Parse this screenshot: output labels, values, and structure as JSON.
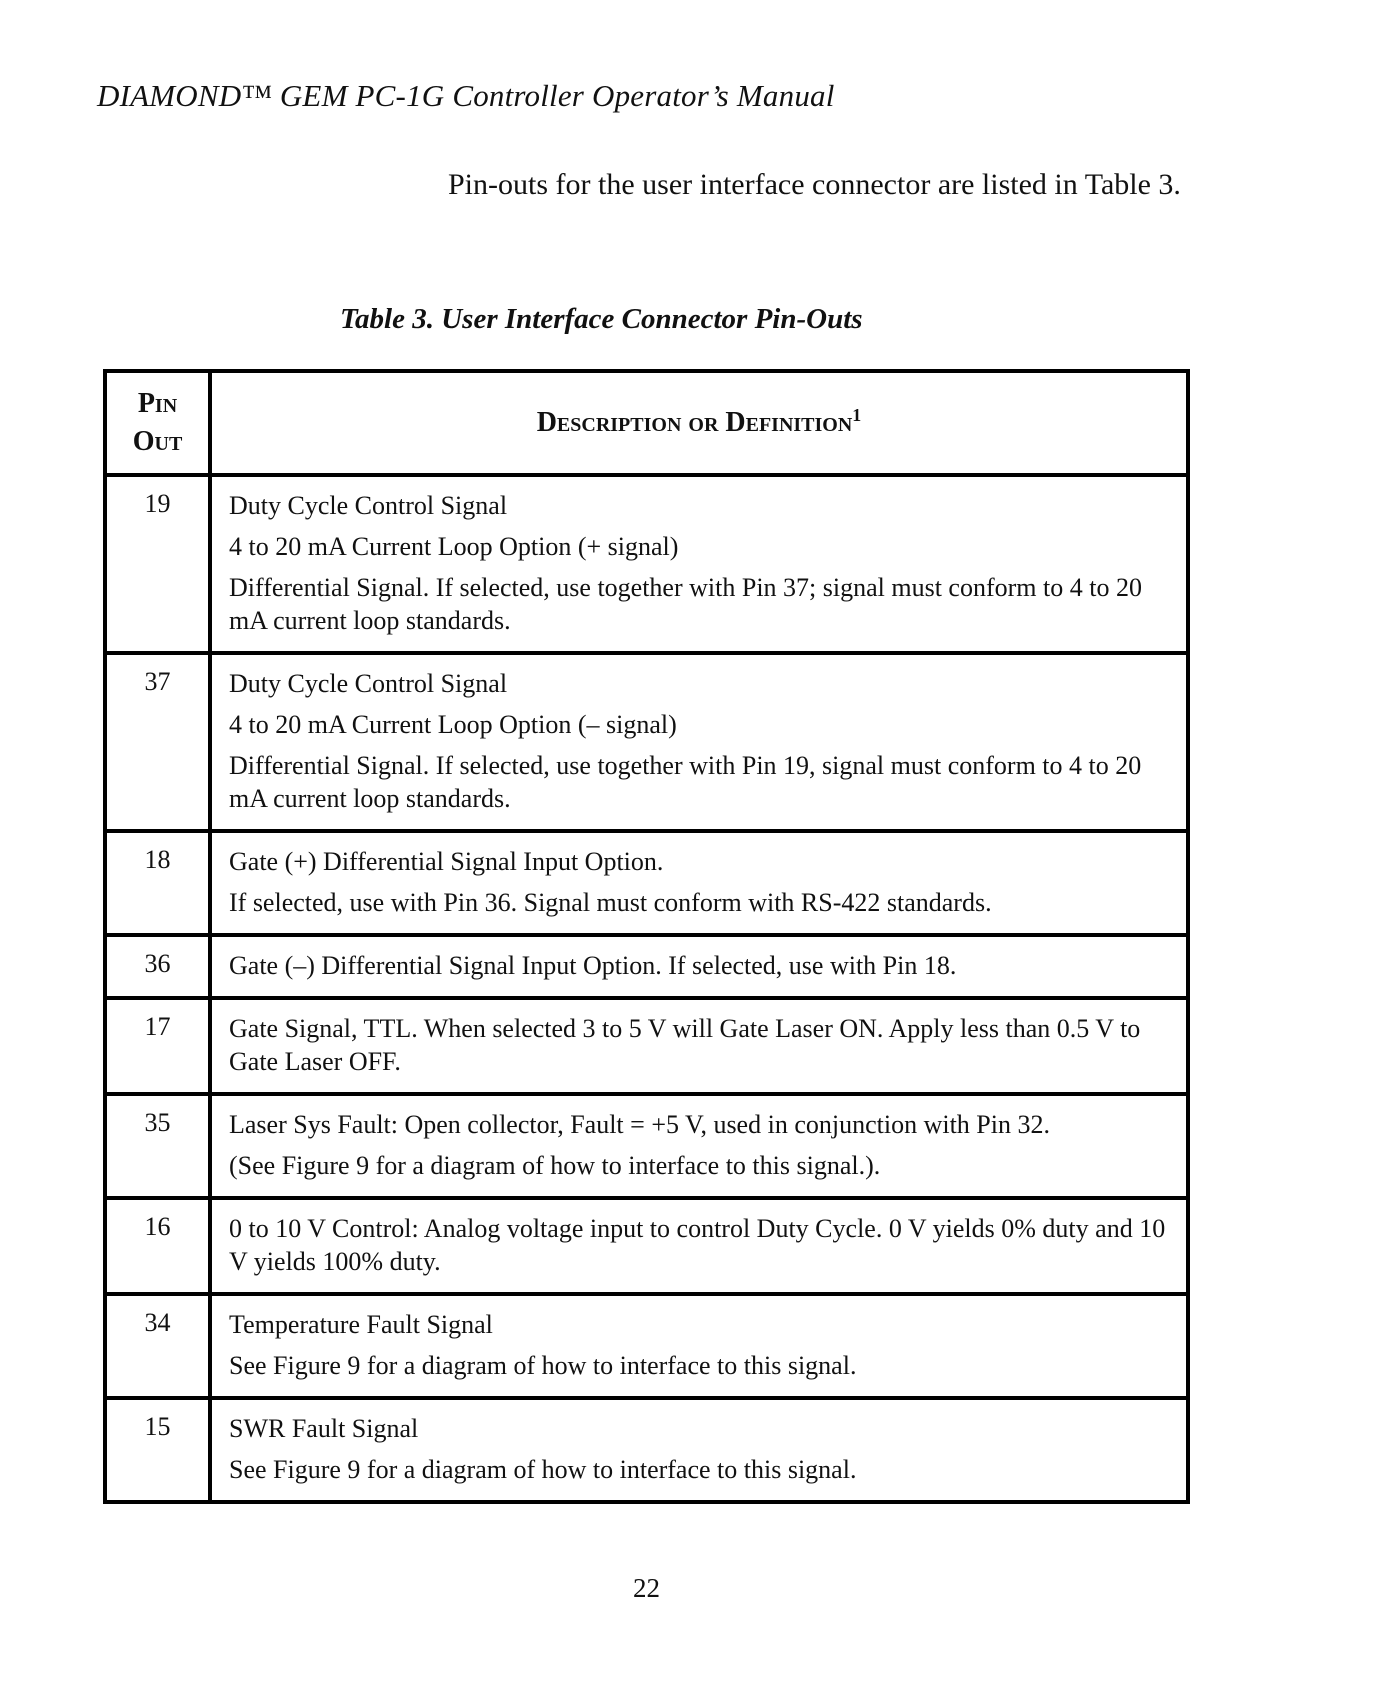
{
  "document": {
    "running_header": "DIAMOND™ GEM PC-1G Controller Operator’s Manual",
    "intro_text": "Pin-outs for the user interface connector are listed in Table 3.",
    "table_caption": "Table 3.  User Interface Connector Pin-Outs",
    "page_number": "22"
  },
  "table": {
    "headers": {
      "pin_line1": "Pin",
      "pin_line2": "Out",
      "description": "Description or Definition",
      "description_footnote": "1"
    },
    "rows": [
      {
        "pin": "19",
        "lines": [
          "Duty Cycle Control Signal",
          "4 to 20 mA Current Loop Option (+ signal)",
          "Differential Signal. If selected, use together with Pin 37; signal must conform to 4 to 20 mA current loop standards."
        ]
      },
      {
        "pin": "37",
        "lines": [
          "Duty Cycle Control Signal",
          "4 to 20 mA Current Loop Option (–  signal)",
          "Differential Signal. If selected, use together with Pin 19, signal must conform to 4 to 20 mA current loop standards."
        ]
      },
      {
        "pin": "18",
        "lines": [
          "Gate (+) Differential Signal Input Option.",
          "If selected, use with Pin 36. Signal must conform with RS-422 standards."
        ]
      },
      {
        "pin": "36",
        "lines": [
          "Gate (–) Differential Signal Input Option. If selected, use with Pin 18."
        ]
      },
      {
        "pin": "17",
        "lines": [
          "Gate Signal, TTL. When selected 3 to 5 V will Gate Laser ON. Apply less than 0.5 V to Gate Laser OFF."
        ]
      },
      {
        "pin": "35",
        "lines": [
          "Laser Sys Fault: Open collector, Fault = +5 V, used in conjunction with Pin 32.",
          "(See Figure 9 for a diagram of how to interface to this signal.)."
        ]
      },
      {
        "pin": "16",
        "lines": [
          "0 to 10 V Control: Analog voltage input to control Duty Cycle. 0 V yields 0% duty and 10 V yields 100% duty."
        ]
      },
      {
        "pin": "34",
        "lines": [
          "Temperature Fault Signal",
          "See Figure 9 for a diagram of how to interface to this signal."
        ]
      },
      {
        "pin": "15",
        "lines": [
          "SWR Fault Signal",
          "See Figure 9 for a diagram of how to interface to this signal."
        ]
      }
    ]
  }
}
